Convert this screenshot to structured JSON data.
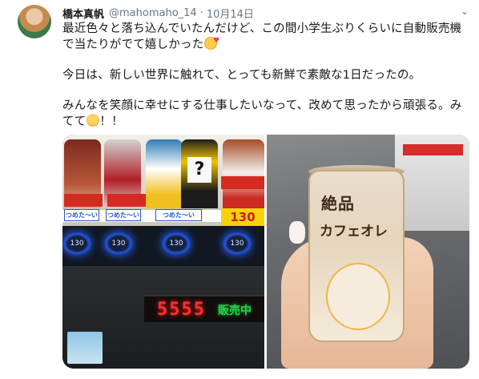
{
  "tweet": {
    "author_name": "橋本真帆",
    "handle": "@mahomaho_14",
    "separator": "·",
    "date": "10月14日",
    "text": {
      "p1": "最近色々と落ち込んでいたんだけど、この間小学生ぶりくらいに自動販売機で当たりがでて嬉しかった",
      "p2": "今日は、新しい世界に触れて、とっても新鮮で素敵な1日だったの。",
      "p3": "みんなを笑顔に幸せにする仕事したいなって、改めて思ったから頑張る。みてて",
      "p3_end": "！！"
    }
  },
  "media": {
    "left_photo": {
      "display_digits": "5555",
      "display_status": "販売中",
      "label_row": [
        "つめた〜い",
        "つめた〜い",
        "つめた〜い"
      ],
      "price_tag": "130",
      "button_values": [
        "130",
        "130",
        "130",
        "130"
      ],
      "question_mark": "?"
    },
    "right_photo": {
      "can_title": "絶品",
      "can_subtitle": "カフェオレ"
    }
  },
  "icons": {
    "chevron": "chevron-down-icon",
    "emoji_1": "smiling-face-with-hearts-icon",
    "emoji_2": "smiling-face-icon"
  }
}
